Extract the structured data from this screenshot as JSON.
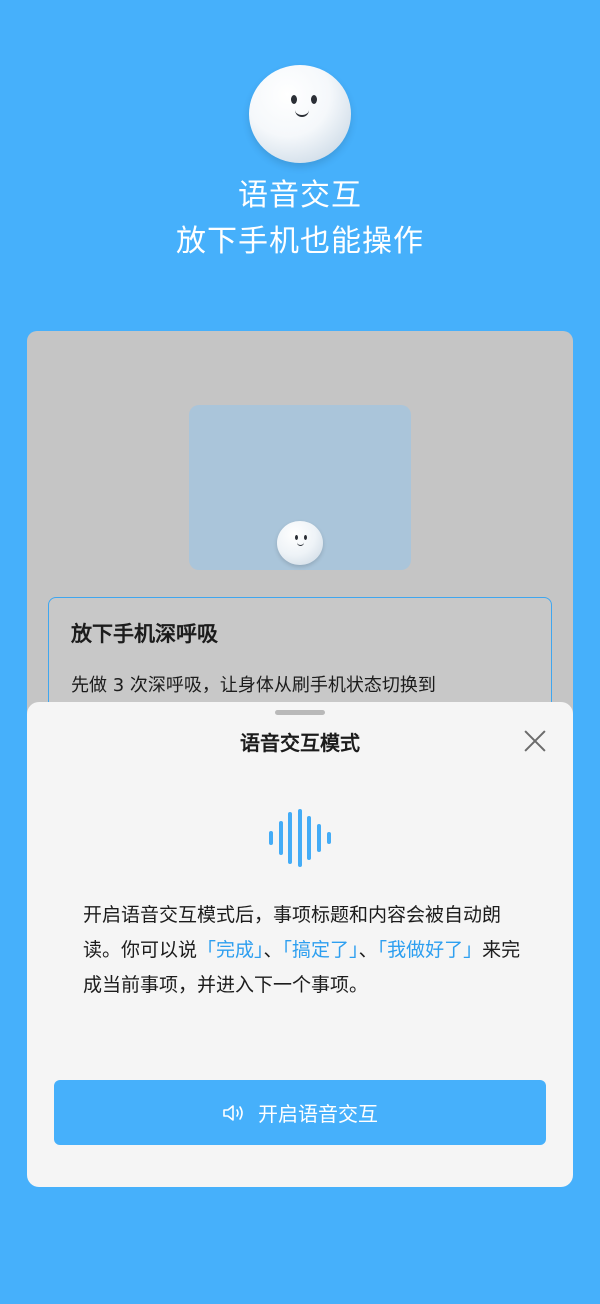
{
  "hero": {
    "title_line1": "语音交互",
    "title_line2": "放下手机也能操作"
  },
  "step": {
    "title": "放下手机深呼吸",
    "description": "先做 3 次深呼吸，让身体从刷手机状态切换到"
  },
  "sheet": {
    "title": "语音交互模式",
    "desc_part1": "开启语音交互模式后，事项标题和内容会被自动朗读。你可以说",
    "option1": "「完成」",
    "sep1": "、",
    "option2": "「搞定了」",
    "sep2": "、",
    "option3": "「我做好了」",
    "desc_part2": "来完成当前事项，并进入下一个事项。",
    "button_label": "开启语音交互",
    "button_icon": "speaker-icon",
    "close_icon": "close-icon",
    "wave_icon": "sound-wave-icon"
  },
  "colors": {
    "background": "#46b0fb",
    "accent": "#2d9ff0",
    "sheet": "#f5f5f5"
  }
}
